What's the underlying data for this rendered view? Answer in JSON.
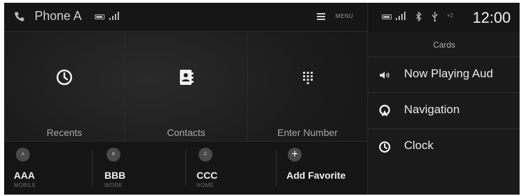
{
  "topbar": {
    "phone_name": "Phone A",
    "menu_label": "MENU"
  },
  "tiles": [
    {
      "label": "Recents",
      "icon": "clock-icon"
    },
    {
      "label": "Contacts",
      "icon": "contacts-book-icon"
    },
    {
      "label": "Enter Number",
      "icon": "keypad-icon"
    }
  ],
  "favorites": [
    {
      "badge": "A",
      "name": "AAA",
      "type": "MOBILE"
    },
    {
      "badge": "B",
      "name": "BBB",
      "type": "WORK"
    },
    {
      "badge": "C",
      "name": "CCC",
      "type": "HOME"
    }
  ],
  "add_favorite": {
    "label": "Add Favorite",
    "symbol": "+"
  },
  "side": {
    "time": "12:00",
    "extra_count": "+2",
    "cards_title": "Cards",
    "cards": [
      {
        "label": "Now Playing Aud",
        "icon": "speaker-icon"
      },
      {
        "label": "Navigation",
        "icon": "navigation-pin-icon"
      },
      {
        "label": "Clock",
        "icon": "clock-icon"
      }
    ]
  },
  "colors": {
    "background": "#1b1b1b",
    "text_primary": "#f0f0f0",
    "text_secondary": "#a9a9a9"
  }
}
